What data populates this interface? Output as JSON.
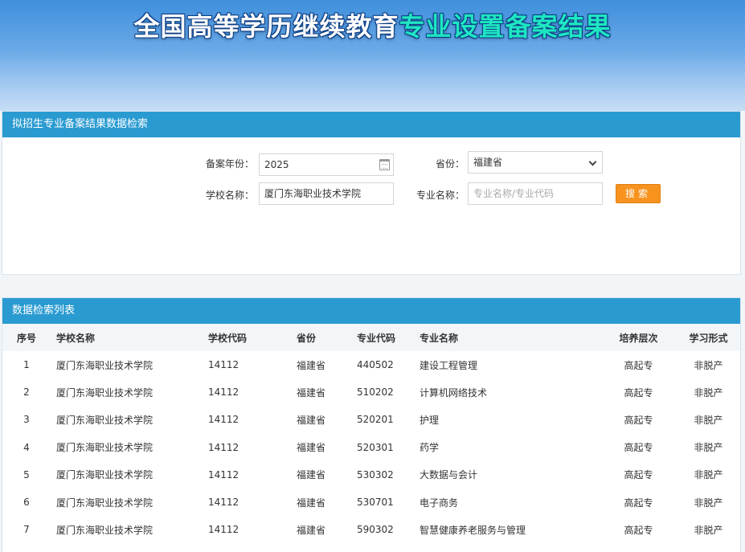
{
  "banner": {
    "title_part1": "全国高等学历继续教育",
    "title_part2": "专业设置备案结果"
  },
  "search": {
    "header": "拟招生专业备案结果数据检索",
    "year_label": "备案年份：",
    "year_value": "2025",
    "province_label": "省份：",
    "province_value": "福建省",
    "school_label": "学校名称：",
    "school_value": "厦门东海职业技术学院",
    "major_label": "专业名称：",
    "major_placeholder": "专业名称/专业代码",
    "search_button": "搜索"
  },
  "results": {
    "header": "数据检索列表",
    "columns": [
      "序号",
      "学校名称",
      "学校代码",
      "省份",
      "专业代码",
      "专业名称",
      "培养层次",
      "学习形式"
    ],
    "rows": [
      [
        "1",
        "厦门东海职业技术学院",
        "14112",
        "福建省",
        "440502",
        "建设工程管理",
        "高起专",
        "非脱产"
      ],
      [
        "2",
        "厦门东海职业技术学院",
        "14112",
        "福建省",
        "510202",
        "计算机网络技术",
        "高起专",
        "非脱产"
      ],
      [
        "3",
        "厦门东海职业技术学院",
        "14112",
        "福建省",
        "520201",
        "护理",
        "高起专",
        "非脱产"
      ],
      [
        "4",
        "厦门东海职业技术学院",
        "14112",
        "福建省",
        "520301",
        "药学",
        "高起专",
        "非脱产"
      ],
      [
        "5",
        "厦门东海职业技术学院",
        "14112",
        "福建省",
        "530302",
        "大数据与会计",
        "高起专",
        "非脱产"
      ],
      [
        "6",
        "厦门东海职业技术学院",
        "14112",
        "福建省",
        "530701",
        "电子商务",
        "高起专",
        "非脱产"
      ],
      [
        "7",
        "厦门东海职业技术学院",
        "14112",
        "福建省",
        "590302",
        "智慧健康养老服务与管理",
        "高起专",
        "非脱产"
      ]
    ]
  },
  "colors": {
    "header_blue": "#2a9bd1",
    "button_orange": "#f7931e",
    "title_accent": "#1fe6c2"
  },
  "icons": {
    "year_field": "calendar-icon",
    "province_field": "chevron-down-icon"
  }
}
